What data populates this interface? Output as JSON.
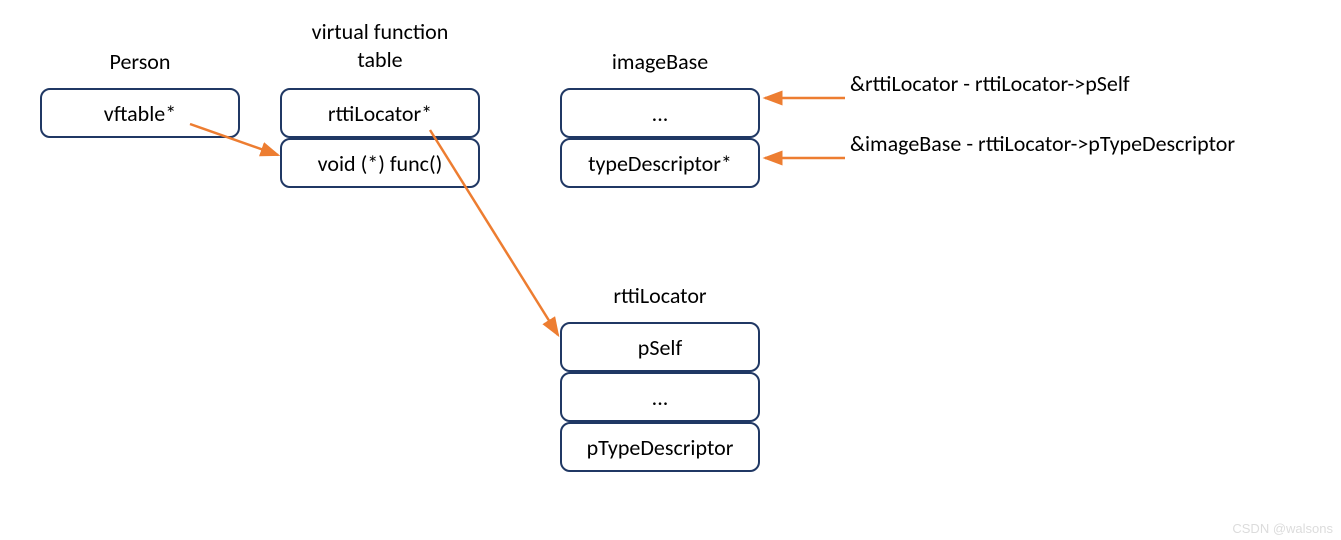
{
  "diagram": {
    "personLabel": "Person",
    "vftLabelLine1": "virtual function",
    "vftLabelLine2": "table",
    "imageBaseLabel": "imageBase",
    "rttiLocatorLabel": "rttiLocator",
    "personCell": "vftable*",
    "vftCell1": "rttiLocator*",
    "vftCell2": "void (*) func()",
    "imageBaseCell1": "...",
    "imageBaseCell2": "typeDescriptor*",
    "rttiCell1": "pSelf",
    "rttiCell2": "...",
    "rttiCell3": "pTypeDescriptor",
    "annotation1": "&rttiLocator - rttiLocator->pSelf",
    "annotation2": "&imageBase - rttiLocator->pTypeDescriptor",
    "watermark": "CSDN @walsons"
  },
  "colors": {
    "border": "#203864",
    "arrow": "#ed7d31"
  }
}
